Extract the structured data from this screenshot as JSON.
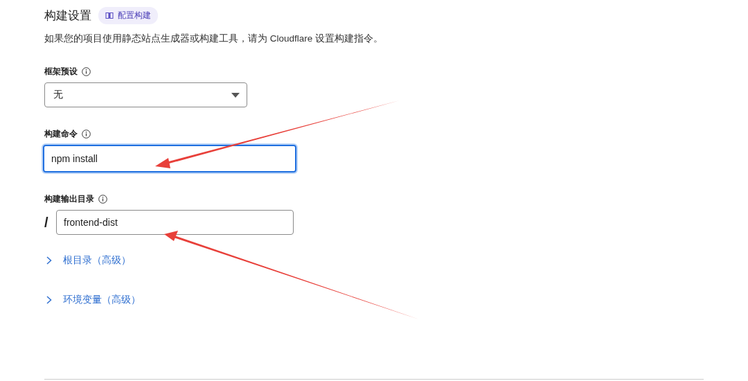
{
  "section": {
    "title": "构建设置",
    "docs_button": "配置构建",
    "description": "如果您的项目使用静态站点生成器或构建工具，请为 Cloudflare 设置构建指令。"
  },
  "fields": [
    {
      "kind": "select",
      "label": "框架预设",
      "value": "无",
      "focused": false
    },
    {
      "kind": "text",
      "label": "构建命令",
      "value": "npm install",
      "focused": true
    },
    {
      "kind": "path",
      "label": "构建输出目录",
      "prefix": "/",
      "value": "frontend-dist",
      "focused": false
    }
  ],
  "expanders": [
    {
      "label": "根目录（高级）",
      "expanded": false
    },
    {
      "label": "环境变量（高级）",
      "expanded": false
    }
  ]
}
